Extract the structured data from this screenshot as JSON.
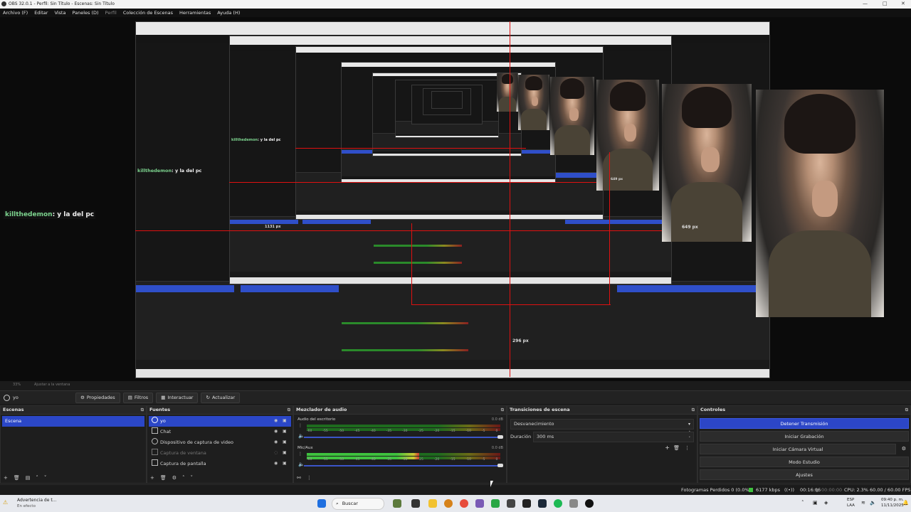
{
  "window": {
    "title": "OBS 32.0.1 - Perfil: Sin Título - Escenas: Sin Título"
  },
  "menu": [
    {
      "label": "Archivo (F)"
    },
    {
      "label": "Editar"
    },
    {
      "label": "Vista"
    },
    {
      "label": "Paneles (D)"
    },
    {
      "label": "Perfil"
    },
    {
      "label": "Colección de Escenas"
    },
    {
      "label": "Herramientas"
    },
    {
      "label": "Ayuda (H)"
    }
  ],
  "preview": {
    "chat_username": "killthedemon",
    "chat_text": ": y la del pc",
    "px_labels": [
      "649 px",
      "649 px",
      "296 px",
      "1131 px"
    ],
    "nested_zoom": "33%",
    "nested_scale": "Ajustar a la ventana"
  },
  "toolbar": {
    "source_name": "yo",
    "properties": "Propiedades",
    "filters": "Filtros",
    "interact": "Interactuar",
    "refresh": "Actualizar"
  },
  "scenes": {
    "title": "Escenas",
    "items": [
      "Escena"
    ]
  },
  "sources": {
    "title": "Fuentes",
    "items": [
      {
        "label": "yo",
        "selected": true,
        "visible": true
      },
      {
        "label": "Chat",
        "selected": false,
        "visible": true
      },
      {
        "label": "Dispositivo de captura de video",
        "selected": false,
        "visible": true
      },
      {
        "label": "Captura de ventana",
        "selected": false,
        "visible": false
      },
      {
        "label": "Captura de pantalla",
        "selected": false,
        "visible": true
      }
    ]
  },
  "mixer": {
    "title": "Mezclador de audio",
    "channels": [
      {
        "name": "Audio del escritorio",
        "db": "0.0 dB",
        "level": 0.0
      },
      {
        "name": "Mic/Aux",
        "db": "0.0 dB",
        "level": 0.58
      }
    ],
    "scale": [
      "-60",
      "-55",
      "-50",
      "-45",
      "-40",
      "-35",
      "-30",
      "-25",
      "-20",
      "-15",
      "-10",
      "-5",
      "0"
    ]
  },
  "transitions": {
    "title": "Transiciones de escena",
    "type": "Desvanecimiento",
    "duration_label": "Duración",
    "duration_value": "300 ms"
  },
  "controls": {
    "title": "Controles",
    "buttons": [
      "Detener Transmisión",
      "Iniciar Grabación",
      "Iniciar Cámara Virtual",
      "Modo Estudio",
      "Ajustes"
    ]
  },
  "status": {
    "dropped": "Fotogramas Perdidos 0 (0.0%)",
    "bitrate": "6177 kbps",
    "stream_time": "00:16:06",
    "rec_time": "00:00:00",
    "cpu": "CPU: 2.3%",
    "fps": "60.00 / 60.00 FPS"
  },
  "taskbar": {
    "notification_title": "Advertencia de t...",
    "notification_sub": "En efecto",
    "search": "Buscar",
    "lang": "ESP",
    "lang_sub": "LAA",
    "time": "09:40 p. m.",
    "date": "11/11/2025"
  },
  "colors": {
    "accent": "#2b47c7",
    "chat_name": "#7cd38e",
    "red_guides": "#e01010"
  }
}
